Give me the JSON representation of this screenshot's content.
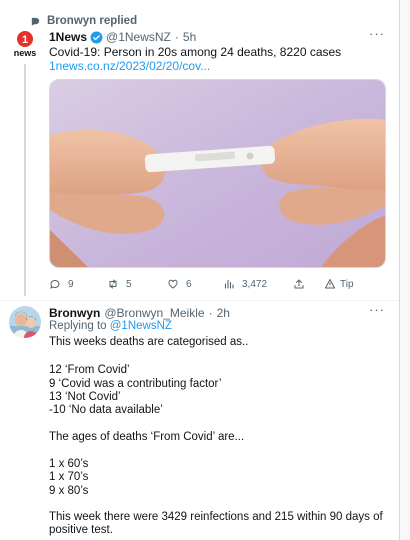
{
  "context": {
    "icon": "reply-arrow-icon",
    "text": "Bronwyn replied"
  },
  "tweet": {
    "name": "1News",
    "handle": "@1NewsNZ",
    "separator": "·",
    "time": "5h",
    "text": "Covid-19: Person in 20s among 24 deaths, 8220 cases",
    "link": "1news.co.nz/2023/02/20/cov...",
    "more_label": "···",
    "avatar_label": "news",
    "stats": {
      "replies": "9",
      "retweets": "5",
      "likes": "6",
      "views": "3,472",
      "tip": "Tip"
    },
    "colors": {
      "verified": "#1d9bf0",
      "link": "#1d9bf0",
      "logo_red": "#e4322b"
    }
  },
  "reply": {
    "name": "Bronwyn",
    "handle": "@Bronwyn_Meikle",
    "separator": "·",
    "time": "2h",
    "more_label": "···",
    "replying_prefix": "Replying to",
    "replying_handle": "@1NewsNZ",
    "lines": [
      "This weeks deaths are categorised as..",
      "",
      "12 ‘From Covid’",
      "9 ‘Covid was a contributing factor’",
      "13 ‘Not Covid’",
      "-10 ‘No data available’",
      "",
      "The ages of deaths ‘From Covid’ are...",
      "",
      "1 x 60’s",
      "1 x 70’s",
      "9 x 80’s",
      "",
      "This week there were 3429 reinfections and 215 within 90 days of",
      "positive test."
    ]
  }
}
